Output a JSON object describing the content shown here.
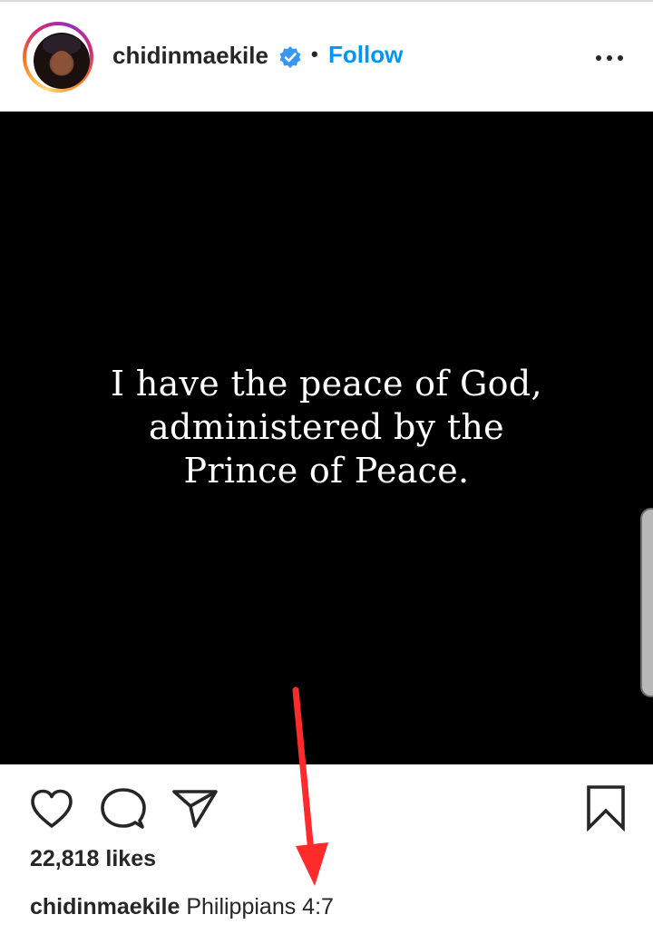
{
  "post": {
    "username": "chidinmaekile",
    "verified": true,
    "separator": "•",
    "follow_label": "Follow",
    "image_quote": [
      "I have the peace of God,",
      "administered by the",
      "Prince of Peace."
    ],
    "likes": "22,818 likes",
    "caption_user": "chidinmaekile",
    "caption_text": "Philippians 4:7"
  },
  "icons": {
    "more": "more-options-icon",
    "verified": "verified-badge-icon",
    "like": "heart-icon",
    "comment": "comment-icon",
    "share": "share-icon",
    "save": "bookmark-icon"
  },
  "colors": {
    "follow": "#0095f6",
    "verified": "#3897f0",
    "annotation_arrow": "#ff2a2a"
  }
}
